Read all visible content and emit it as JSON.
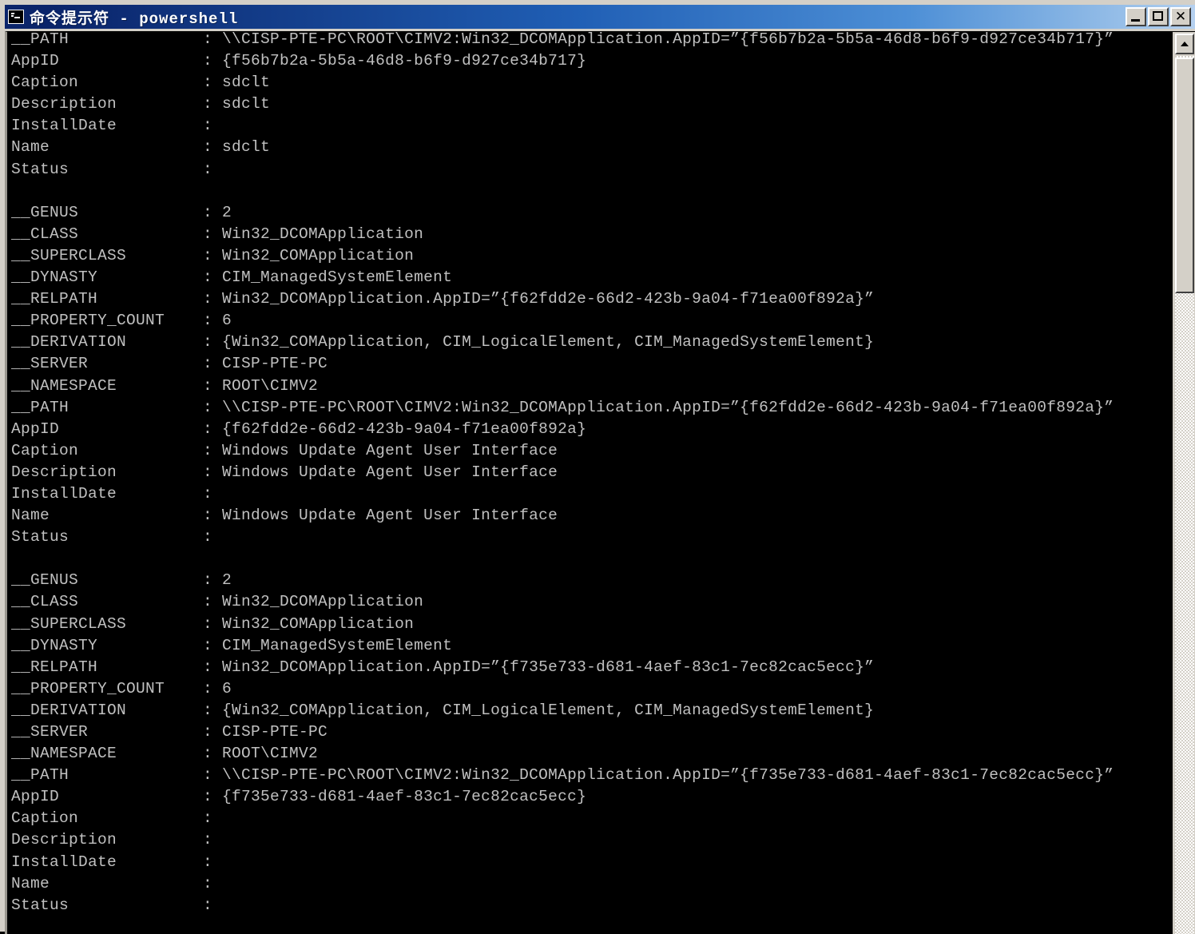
{
  "window": {
    "title_cjk": "命令提示符",
    "title_separator": " - ",
    "title_shell": "powershell",
    "icon": "console-icon",
    "colors": {
      "titlebar_start": "#0a246a",
      "titlebar_end": "#b6d1f0",
      "frame": "#d4d0c8",
      "console_bg": "#000000",
      "console_fg": "#c0c0c0"
    },
    "buttons": {
      "minimize": "minimize",
      "maximize": "maximize",
      "close": "✕"
    }
  },
  "scrollbar": {
    "up_arrow": "▲",
    "thumb_label": "scroll-thumb"
  },
  "console": {
    "text": "__PATH              : \\\\CISP-PTE-PC\\ROOT\\CIMV2:Win32_DCOMApplication.AppID=”{f56b7b2a-5b5a-46d8-b6f9-d927ce34b717}”\nAppID               : {f56b7b2a-5b5a-46d8-b6f9-d927ce34b717}\nCaption             : sdclt\nDescription         : sdclt\nInstallDate         :\nName                : sdclt\nStatus              :\n\n__GENUS             : 2\n__CLASS             : Win32_DCOMApplication\n__SUPERCLASS        : Win32_COMApplication\n__DYNASTY           : CIM_ManagedSystemElement\n__RELPATH           : Win32_DCOMApplication.AppID=”{f62fdd2e-66d2-423b-9a04-f71ea00f892a}”\n__PROPERTY_COUNT    : 6\n__DERIVATION        : {Win32_COMApplication, CIM_LogicalElement, CIM_ManagedSystemElement}\n__SERVER            : CISP-PTE-PC\n__NAMESPACE         : ROOT\\CIMV2\n__PATH              : \\\\CISP-PTE-PC\\ROOT\\CIMV2:Win32_DCOMApplication.AppID=”{f62fdd2e-66d2-423b-9a04-f71ea00f892a}”\nAppID               : {f62fdd2e-66d2-423b-9a04-f71ea00f892a}\nCaption             : Windows Update Agent User Interface\nDescription         : Windows Update Agent User Interface\nInstallDate         :\nName                : Windows Update Agent User Interface\nStatus              :\n\n__GENUS             : 2\n__CLASS             : Win32_DCOMApplication\n__SUPERCLASS        : Win32_COMApplication\n__DYNASTY           : CIM_ManagedSystemElement\n__RELPATH           : Win32_DCOMApplication.AppID=”{f735e733-d681-4aef-83c1-7ec82cac5ecc}”\n__PROPERTY_COUNT    : 6\n__DERIVATION        : {Win32_COMApplication, CIM_LogicalElement, CIM_ManagedSystemElement}\n__SERVER            : CISP-PTE-PC\n__NAMESPACE         : ROOT\\CIMV2\n__PATH              : \\\\CISP-PTE-PC\\ROOT\\CIMV2:Win32_DCOMApplication.AppID=”{f735e733-d681-4aef-83c1-7ec82cac5ecc}”\nAppID               : {f735e733-d681-4aef-83c1-7ec82cac5ecc}\nCaption             :\nDescription         :\nInstallDate         :\nName                :\nStatus              :"
  }
}
